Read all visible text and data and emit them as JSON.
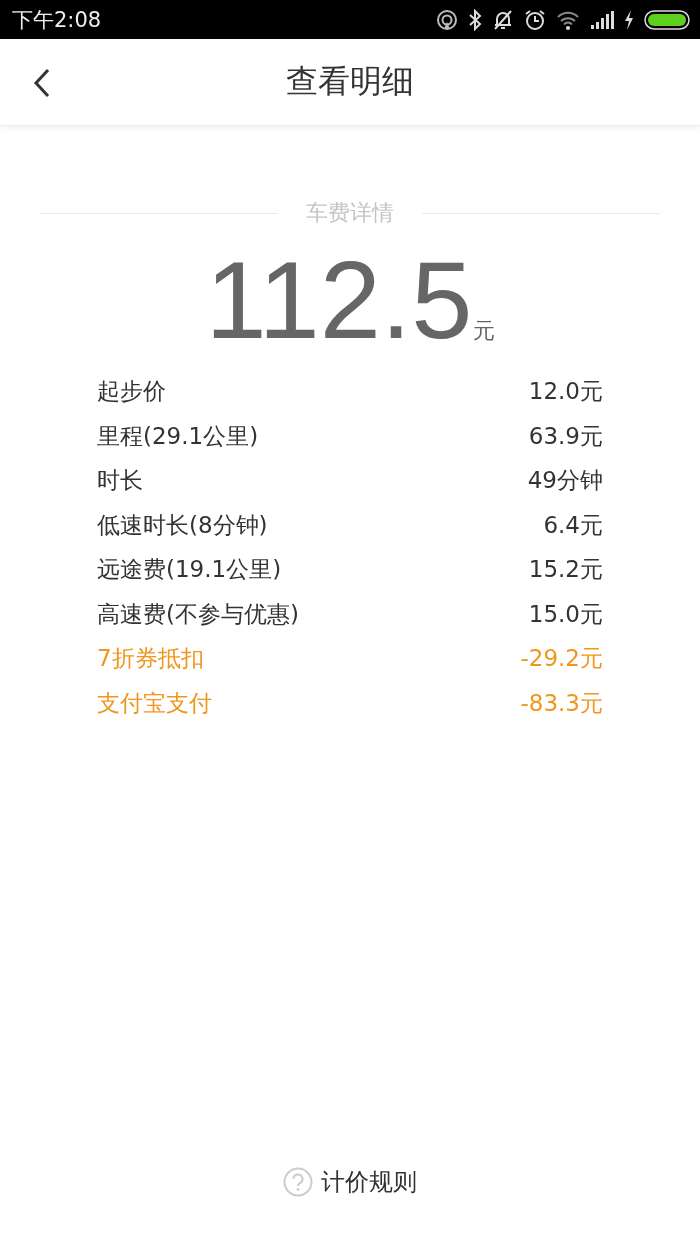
{
  "status_bar": {
    "time": "下午2:08"
  },
  "header": {
    "title": "查看明细"
  },
  "section_title": "车费详情",
  "total": {
    "amount": "112.5",
    "unit": "元"
  },
  "items": [
    {
      "label": "起步价",
      "value": "12.0元",
      "kind": "charge"
    },
    {
      "label": "里程(29.1公里)",
      "value": "63.9元",
      "kind": "charge"
    },
    {
      "label": "时长",
      "value": "49分钟",
      "kind": "charge"
    },
    {
      "label": "低速时长(8分钟)",
      "value": "6.4元",
      "kind": "charge"
    },
    {
      "label": "远途费(19.1公里)",
      "value": "15.2元",
      "kind": "charge"
    },
    {
      "label": "高速费(不参与优惠)",
      "value": "15.0元",
      "kind": "charge"
    },
    {
      "label": "7折券抵扣",
      "value": "-29.2元",
      "kind": "discount"
    },
    {
      "label": "支付宝支付",
      "value": "-83.3元",
      "kind": "discount"
    }
  ],
  "footer_link": "计价规则"
}
